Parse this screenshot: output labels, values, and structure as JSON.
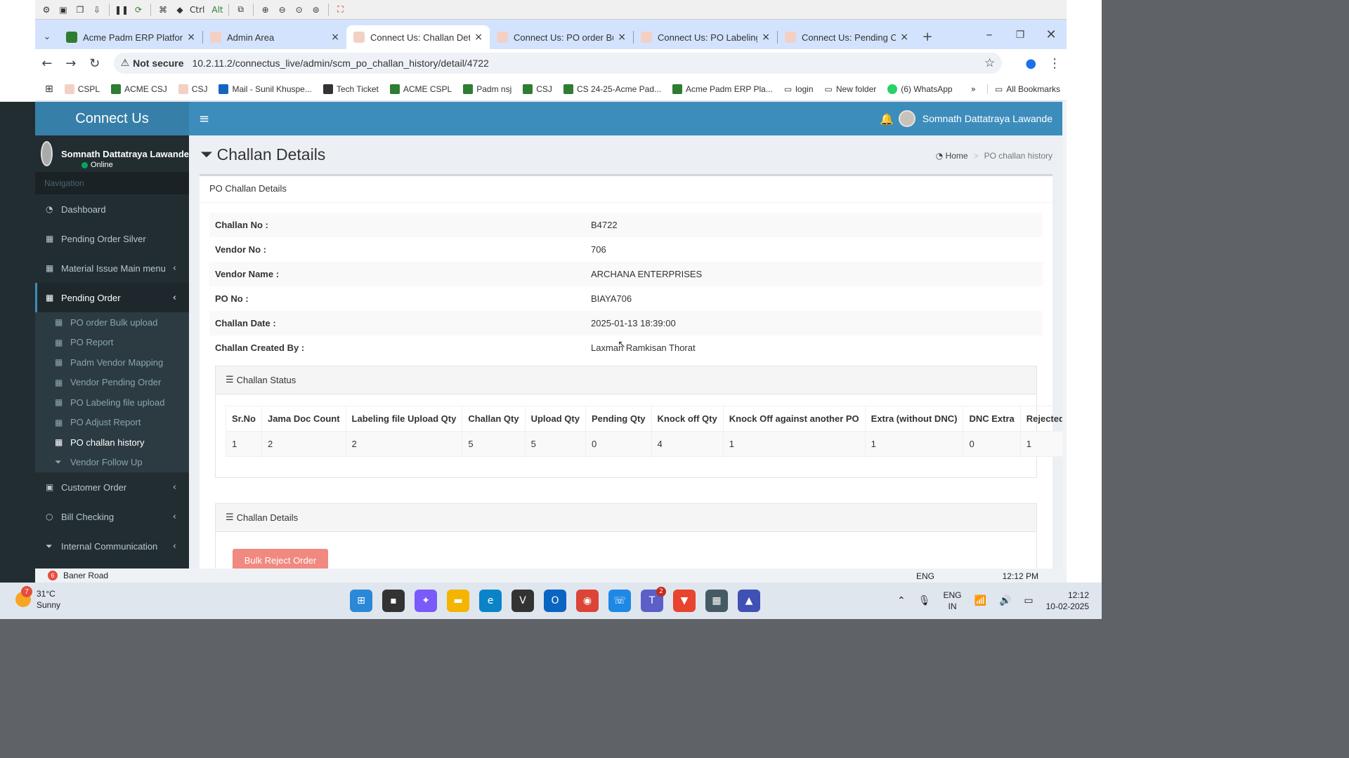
{
  "vnc_toolbar": {
    "ctrl": "Ctrl",
    "alt": "Alt"
  },
  "tabs": [
    {
      "title": "Acme Padm ERP Platform",
      "color": "#2e7d32"
    },
    {
      "title": "Admin Area",
      "color": "#e8b4a0"
    },
    {
      "title": "Connect Us: Challan Details",
      "color": "#e8b4a0"
    },
    {
      "title": "Connect Us: PO order Bulk",
      "color": "#e8b4a0"
    },
    {
      "title": "Connect Us: PO Labeling fi",
      "color": "#e8b4a0"
    },
    {
      "title": "Connect Us: Pending Order",
      "color": "#e8b4a0"
    }
  ],
  "address": {
    "security": "Not secure",
    "url": "10.2.11.2/connectus_live/admin/scm_po_challan_history/detail/4722"
  },
  "bookmarks": [
    {
      "label": "CSPL",
      "color": "#e8b4a0"
    },
    {
      "label": "ACME CSJ",
      "color": "#2e7d32"
    },
    {
      "label": "CSJ",
      "color": "#e8b4a0"
    },
    {
      "label": "Mail - Sunil Khuspe...",
      "color": "#1565c0"
    },
    {
      "label": "Tech Ticket",
      "color": "#333"
    },
    {
      "label": "ACME CSPL",
      "color": "#2e7d32"
    },
    {
      "label": "Padm nsj",
      "color": "#2e7d32"
    },
    {
      "label": "CSJ",
      "color": "#2e7d32"
    },
    {
      "label": "CS 24-25-Acme Pad...",
      "color": "#2e7d32"
    },
    {
      "label": "Acme Padm ERP Pla...",
      "color": "#2e7d32"
    },
    {
      "label": "login",
      "color": "folder"
    },
    {
      "label": "New folder",
      "color": "folder"
    },
    {
      "label": "(6) WhatsApp",
      "color": "#25d366"
    }
  ],
  "bookmarks_all": "All Bookmarks",
  "app": {
    "logo": "Connect Us",
    "user_name": "Somnath Dattatraya Lawande",
    "sidebar_user": "Somnath Dattatraya Lawande",
    "status": "Online"
  },
  "sidebar": {
    "nav_header": "Navigation",
    "items": [
      {
        "label": "Dashboard"
      },
      {
        "label": "Pending Order Silver"
      },
      {
        "label": "Material Issue Main menu"
      },
      {
        "label": "Pending Order"
      }
    ],
    "sub_items": [
      {
        "label": "PO order Bulk upload"
      },
      {
        "label": "PO Report"
      },
      {
        "label": "Padm Vendor Mapping"
      },
      {
        "label": "Vendor Pending Order"
      },
      {
        "label": "PO Labeling file upload"
      },
      {
        "label": "PO Adjust Report"
      },
      {
        "label": "PO challan history"
      },
      {
        "label": "Vendor Follow Up"
      }
    ],
    "bottom_items": [
      {
        "label": "Customer Order"
      },
      {
        "label": "Bill Checking"
      },
      {
        "label": "Internal Communication"
      }
    ]
  },
  "page": {
    "title": "Challan Details",
    "crumb_home": "Home",
    "crumb_current": "PO challan history",
    "box_title": "PO Challan Details"
  },
  "details": [
    {
      "k": "Challan No :",
      "v": "B4722"
    },
    {
      "k": "Vendor No :",
      "v": "706"
    },
    {
      "k": "Vendor Name :",
      "v": "ARCHANA ENTERPRISES"
    },
    {
      "k": "PO No :",
      "v": "BIAYA706"
    },
    {
      "k": "Challan Date :",
      "v": "2025-01-13 18:39:00"
    },
    {
      "k": "Challan Created By :",
      "v": "Laxman Ramkisan Thorat"
    }
  ],
  "status_panel": {
    "title": "Challan Status",
    "headers": [
      "Sr.No",
      "Jama Doc Count",
      "Labeling file Upload Qty",
      "Challan Qty",
      "Upload Qty",
      "Pending Qty",
      "Knock off Qty",
      "Knock Off against another PO",
      "Extra (without DNC)",
      "DNC Extra",
      "Rejected"
    ],
    "row": [
      "1",
      "2",
      "2",
      "5",
      "5",
      "0",
      "4",
      "1",
      "1",
      "0",
      "1"
    ]
  },
  "details_panel": {
    "title": "Challan Details",
    "button": "Bulk Reject Order"
  },
  "remote_status": {
    "badge": "6",
    "location": "Baner Road",
    "lang": "ENG",
    "time": "12:12 PM"
  },
  "taskbar": {
    "weather_badge": "7",
    "temp": "31°C",
    "cond": "Sunny",
    "lang1": "ENG",
    "lang2": "IN",
    "time": "12:12",
    "date": "10-02-2025",
    "teams_badge": "2"
  }
}
